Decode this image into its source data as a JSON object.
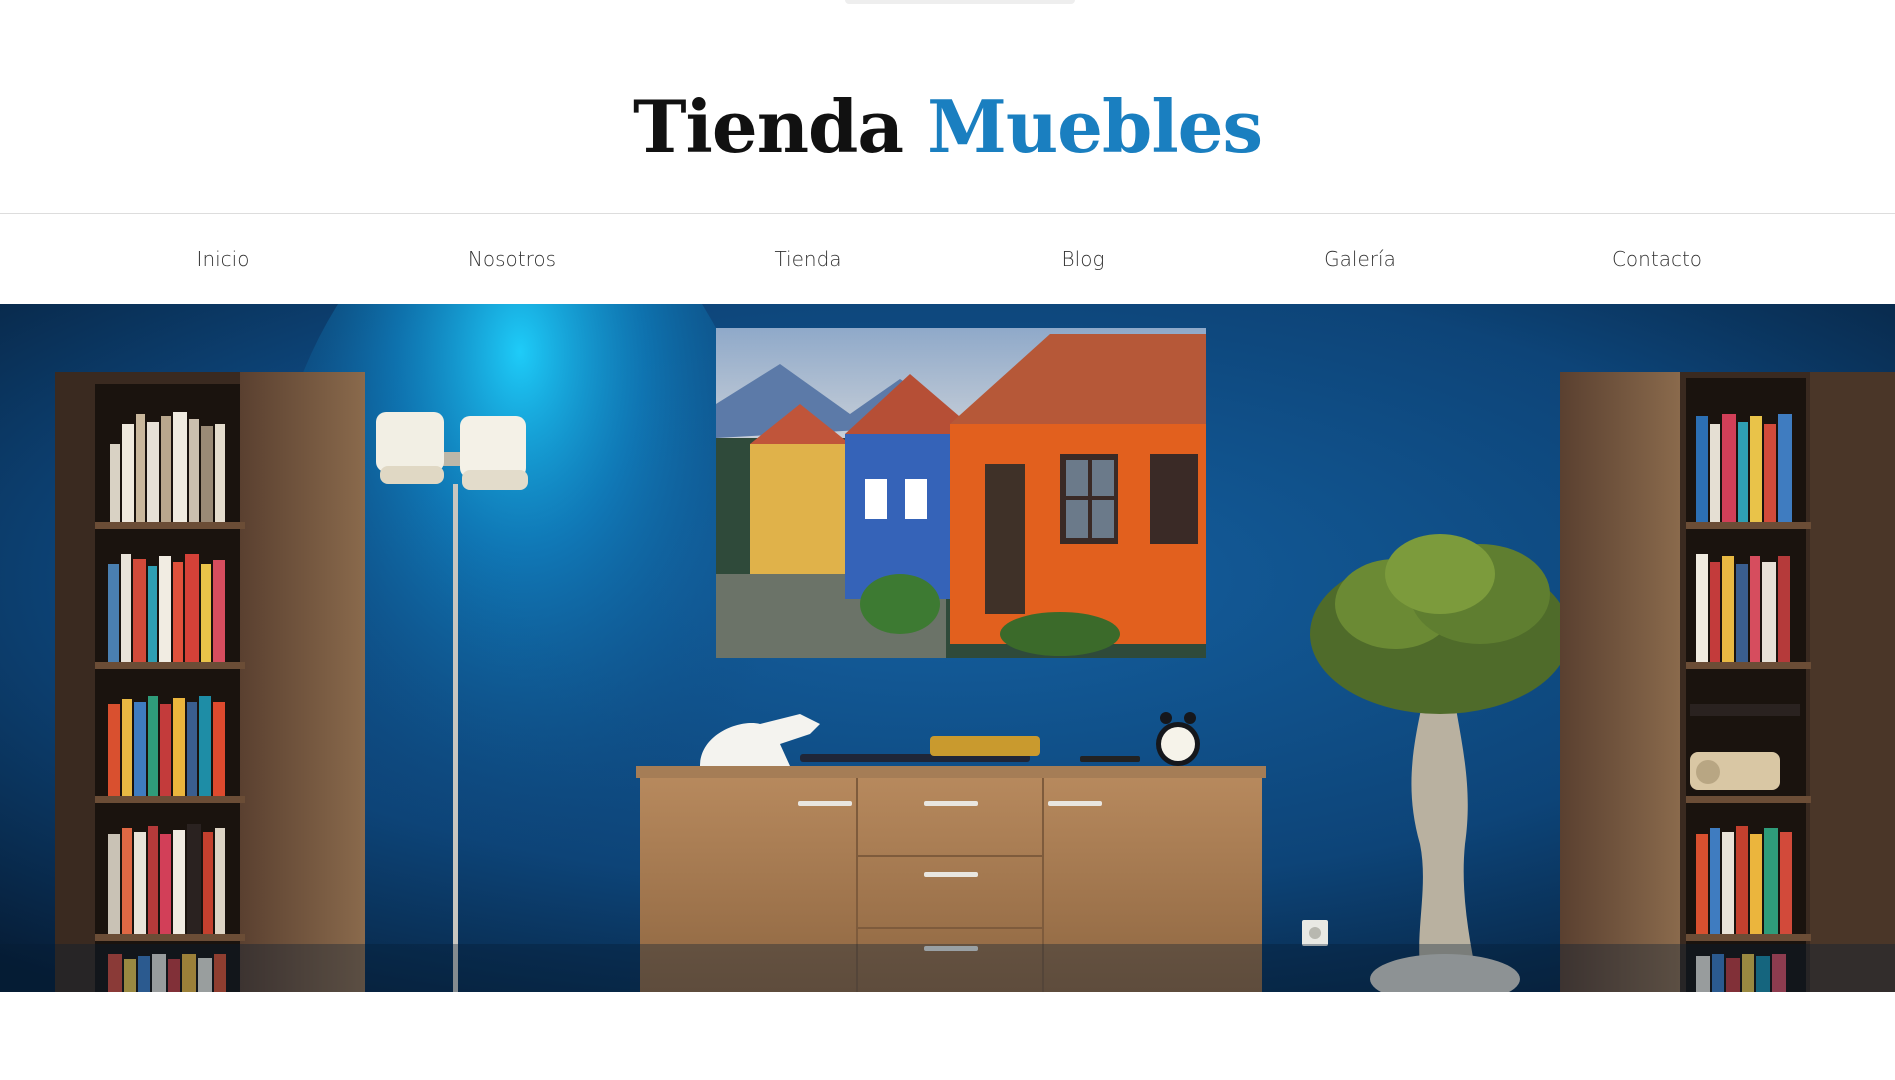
{
  "header": {
    "logo_part1": "Tienda",
    "logo_part2": "Muebles",
    "accent_color": "#1a7fc0"
  },
  "nav": {
    "items": [
      {
        "label": "Inicio"
      },
      {
        "label": "Nosotros"
      },
      {
        "label": "Tienda"
      },
      {
        "label": "Blog"
      },
      {
        "label": "Galería"
      },
      {
        "label": "Contacto"
      }
    ]
  },
  "hero": {
    "scene": "living-room-image",
    "wall_color": "#0f4a80"
  }
}
